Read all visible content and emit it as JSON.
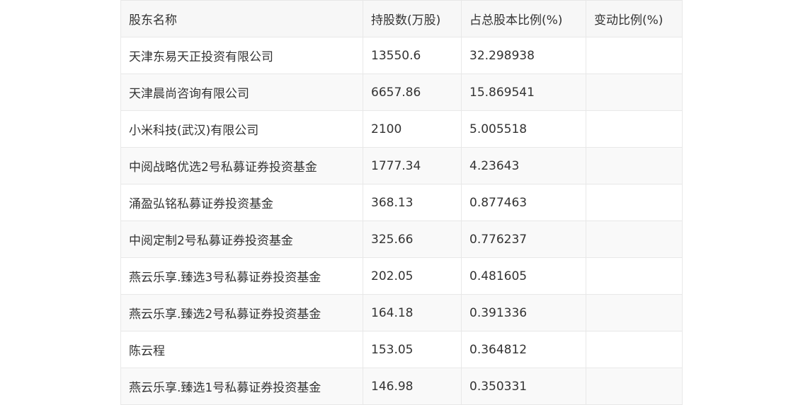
{
  "table": {
    "headers": [
      "股东名称",
      "持股数(万股)",
      "占总股本比例(%)",
      "变动比例(%)"
    ],
    "rows": [
      [
        "天津东易天正投资有限公司",
        "13550.6",
        "32.298938",
        ""
      ],
      [
        "天津晨尚咨询有限公司",
        "6657.86",
        "15.869541",
        ""
      ],
      [
        "小米科技(武汉)有限公司",
        "2100",
        "5.005518",
        ""
      ],
      [
        "中阅战略优选2号私募证券投资基金",
        "1777.34",
        "4.23643",
        ""
      ],
      [
        "涌盈弘铭私募证券投资基金",
        "368.13",
        "0.877463",
        ""
      ],
      [
        "中阅定制2号私募证券投资基金",
        "325.66",
        "0.776237",
        ""
      ],
      [
        "燕云乐享.臻选3号私募证券投资基金",
        "202.05",
        "0.481605",
        ""
      ],
      [
        "燕云乐享.臻选2号私募证券投资基金",
        "164.18",
        "0.391336",
        ""
      ],
      [
        "陈云程",
        "153.05",
        "0.364812",
        ""
      ],
      [
        "燕云乐享.臻选1号私募证券投资基金",
        "146.98",
        "0.350331",
        ""
      ]
    ]
  }
}
